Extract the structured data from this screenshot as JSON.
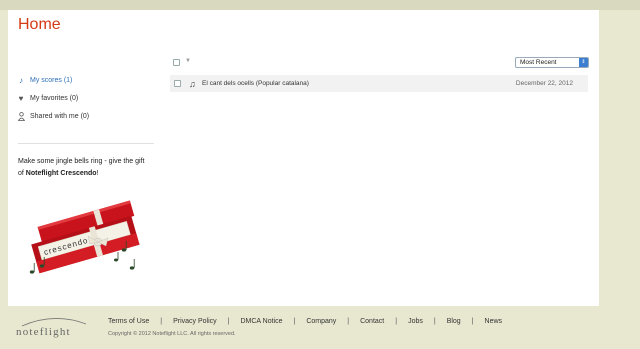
{
  "page": {
    "title": "Home"
  },
  "sidebar": {
    "items": [
      {
        "label": "My scores (1)",
        "icon": "music-note-icon",
        "active": true
      },
      {
        "label": "My favorites (0)",
        "icon": "heart-icon",
        "active": false
      },
      {
        "label": "Shared with me (0)",
        "icon": "person-icon",
        "active": false
      }
    ],
    "promo": {
      "text_before": "Make some jingle bells ring - give the gift of ",
      "text_bold": "Noteflight Crescendo",
      "text_after": "!",
      "image_word": "crescendo"
    }
  },
  "list": {
    "sort_selected": "Most Recent",
    "rows": [
      {
        "title": "El cant dels ocells (Popular catalana)",
        "date": "December 22, 2012"
      }
    ]
  },
  "footer": {
    "logo_text": "noteflight",
    "links": [
      "Terms of Use",
      "Privacy Policy",
      "DMCA Notice",
      "Company",
      "Contact",
      "Jobs",
      "Blog",
      "News"
    ],
    "copyright": "Copyright © 2012 Noteflight LLC. All rights reserved."
  },
  "colors": {
    "accent": "#d43a14",
    "link": "#2d6fb7",
    "background": "#e8e8d0"
  }
}
